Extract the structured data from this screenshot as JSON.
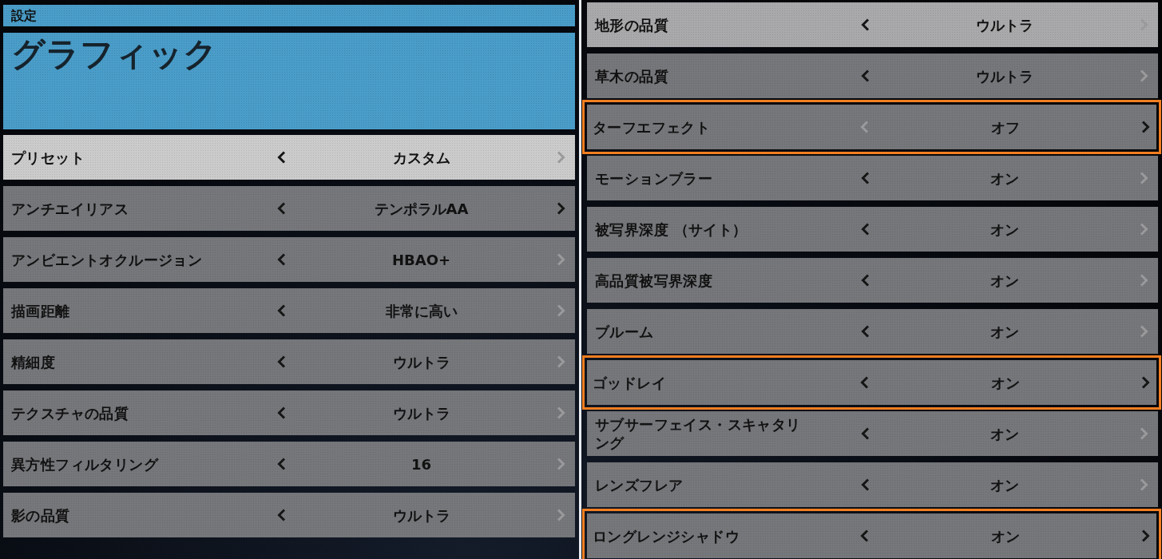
{
  "breadcrumb": "設定",
  "title": "グラフィック",
  "left_settings": [
    {
      "label": "プリセット",
      "value": "カスタム",
      "selected": true,
      "hovered": false,
      "modified": false,
      "prev_enabled": true,
      "next_enabled": false
    },
    {
      "label": "アンチエイリアス",
      "value": "テンポラルAA",
      "selected": false,
      "hovered": false,
      "modified": false,
      "prev_enabled": true,
      "next_enabled": true
    },
    {
      "label": "アンビエントオクルージョン",
      "value": "HBAO+",
      "selected": false,
      "hovered": false,
      "modified": false,
      "prev_enabled": true,
      "next_enabled": false
    },
    {
      "label": "描画距離",
      "value": "非常に高い",
      "selected": false,
      "hovered": false,
      "modified": false,
      "prev_enabled": true,
      "next_enabled": false
    },
    {
      "label": "精細度",
      "value": "ウルトラ",
      "selected": false,
      "hovered": false,
      "modified": false,
      "prev_enabled": true,
      "next_enabled": false
    },
    {
      "label": "テクスチャの品質",
      "value": "ウルトラ",
      "selected": false,
      "hovered": false,
      "modified": false,
      "prev_enabled": true,
      "next_enabled": false
    },
    {
      "label": "異方性フィルタリング",
      "value": "16",
      "selected": false,
      "hovered": false,
      "modified": false,
      "prev_enabled": true,
      "next_enabled": false
    },
    {
      "label": "影の品質",
      "value": "ウルトラ",
      "selected": false,
      "hovered": false,
      "modified": false,
      "prev_enabled": true,
      "next_enabled": false
    }
  ],
  "right_settings": [
    {
      "label": "地形の品質",
      "value": "ウルトラ",
      "selected": false,
      "hovered": true,
      "modified": false,
      "prev_enabled": true,
      "next_enabled": false
    },
    {
      "label": "草木の品質",
      "value": "ウルトラ",
      "selected": false,
      "hovered": false,
      "modified": false,
      "prev_enabled": true,
      "next_enabled": false
    },
    {
      "label": "ターフエフェクト",
      "value": "オフ",
      "selected": false,
      "hovered": false,
      "modified": true,
      "prev_enabled": false,
      "next_enabled": true
    },
    {
      "label": "モーションブラー",
      "value": "オン",
      "selected": false,
      "hovered": false,
      "modified": false,
      "prev_enabled": true,
      "next_enabled": false
    },
    {
      "label": "被写界深度 （サイト）",
      "value": "オン",
      "selected": false,
      "hovered": false,
      "modified": false,
      "prev_enabled": true,
      "next_enabled": false
    },
    {
      "label": "高品質被写界深度",
      "value": "オン",
      "selected": false,
      "hovered": false,
      "modified": false,
      "prev_enabled": true,
      "next_enabled": false
    },
    {
      "label": "ブルーム",
      "value": "オン",
      "selected": false,
      "hovered": false,
      "modified": false,
      "prev_enabled": true,
      "next_enabled": false
    },
    {
      "label": "ゴッドレイ",
      "value": "オン",
      "selected": false,
      "hovered": false,
      "modified": true,
      "prev_enabled": true,
      "next_enabled": true
    },
    {
      "label": "サブサーフェイス・スキャタリング",
      "value": "オン",
      "selected": false,
      "hovered": false,
      "modified": false,
      "prev_enabled": true,
      "next_enabled": false
    },
    {
      "label": "レンズフレア",
      "value": "オン",
      "selected": false,
      "hovered": false,
      "modified": false,
      "prev_enabled": true,
      "next_enabled": false
    },
    {
      "label": "ロングレンジシャドウ",
      "value": "オン",
      "selected": false,
      "hovered": false,
      "modified": true,
      "prev_enabled": true,
      "next_enabled": true
    }
  ]
}
